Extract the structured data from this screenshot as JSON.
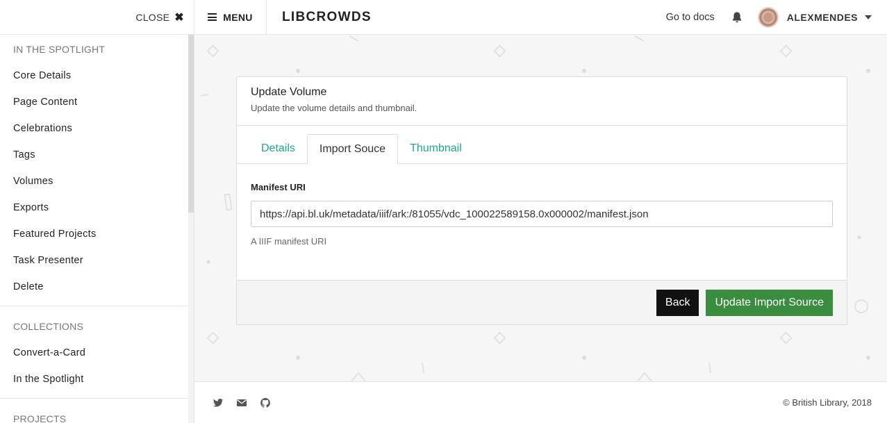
{
  "sidebar": {
    "close_label": "CLOSE",
    "sections": [
      {
        "heading": "IN THE SPOTLIGHT",
        "items": [
          "Core Details",
          "Page Content",
          "Celebrations",
          "Tags",
          "Volumes",
          "Exports",
          "Featured Projects",
          "Task Presenter",
          "Delete"
        ]
      },
      {
        "heading": "COLLECTIONS",
        "items": [
          "Convert-a-Card",
          "In the Spotlight"
        ]
      },
      {
        "heading": "PROJECTS",
        "items": []
      }
    ]
  },
  "topbar": {
    "menu_label": "MENU",
    "brand": "LIBCROWDS",
    "docs_link": "Go to docs",
    "username": "ALEXMENDES"
  },
  "card": {
    "title": "Update Volume",
    "subtitle": "Update the volume details and thumbnail.",
    "tabs": [
      {
        "label": "Details",
        "active": false
      },
      {
        "label": "Import Souce",
        "active": true
      },
      {
        "label": "Thumbnail",
        "active": false
      }
    ],
    "field_label": "Manifest URI",
    "field_value": "https://api.bl.uk/metadata/iiif/ark:/81055/vdc_100022589158.0x000002/manifest.json",
    "help_text": "A IIIF manifest URI",
    "back_label": "Back",
    "submit_label": "Update Import Source"
  },
  "footer": {
    "icons": [
      "twitter-icon",
      "mail-icon",
      "github-icon"
    ],
    "copyright": "© British Library, 2018"
  },
  "colors": {
    "accent": "#1aa88f",
    "success": "#3a8c3f",
    "dark": "#111111"
  }
}
